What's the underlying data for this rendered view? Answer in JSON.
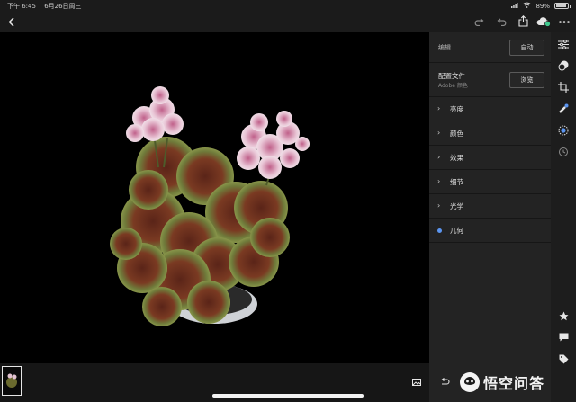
{
  "status_bar": {
    "time": "下午 6:45",
    "date": "6月26日周三",
    "battery": "89%",
    "battery_level": 0.89
  },
  "top_bar": {
    "back_icon": "chevron-left-icon",
    "redo_icon": "redo-icon",
    "undo_icon": "undo-icon",
    "share_icon": "share-icon",
    "cloud_icon": "cloud-sync-icon",
    "more_icon": "more-icon"
  },
  "edit_panel": {
    "header_label": "编辑",
    "auto_button": "自动",
    "profile_label": "配置文件",
    "profile_value": "Adobe 颜色",
    "browse_button": "浏览",
    "sections": [
      {
        "label": "亮度",
        "state": "collapsed"
      },
      {
        "label": "颜色",
        "state": "collapsed"
      },
      {
        "label": "效果",
        "state": "collapsed"
      },
      {
        "label": "细节",
        "state": "collapsed"
      },
      {
        "label": "光学",
        "state": "collapsed"
      },
      {
        "label": "几何",
        "state": "active"
      }
    ]
  },
  "right_toolbar": [
    "sliders-icon",
    "presets-icon",
    "crop-rotate-icon",
    "healing-brush-icon",
    "selective-icon",
    "versions-icon",
    "star-icon",
    "comment-icon",
    "tag-icon"
  ],
  "watermark": "悟空问答",
  "colors": {
    "accent": "#5b95f0",
    "cloud_sync": "#3fc98e",
    "panel_bg": "#232323",
    "canvas_bg": "#000000"
  }
}
